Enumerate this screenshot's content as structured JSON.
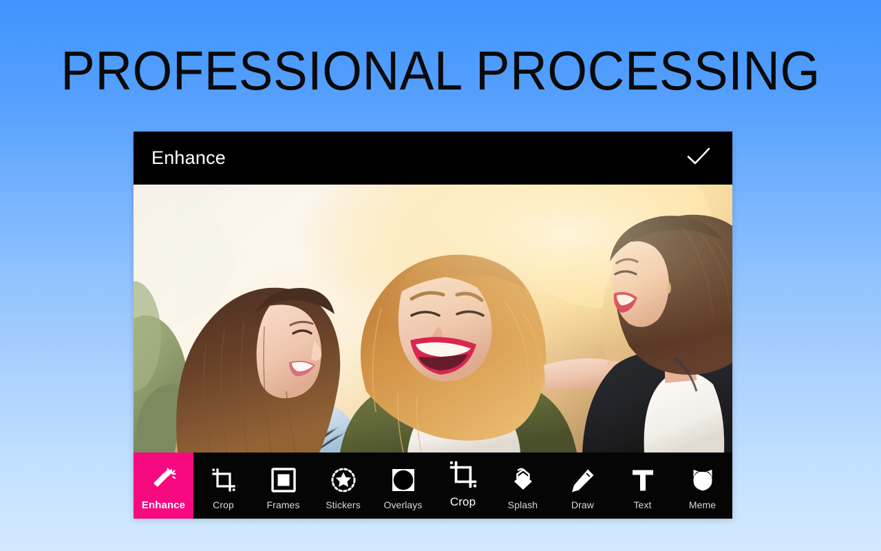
{
  "page": {
    "headline": "PROFESSIONAL PROCESSING",
    "background_top_color": "#3f94fd",
    "background_bottom_color": "#d3e9ff"
  },
  "app": {
    "topbar": {
      "title": "Enhance",
      "confirm_icon": "check-icon"
    },
    "photo": {
      "description": "Three young women laughing together outdoors in warm backlit sunlight",
      "subjects": [
        {
          "position": "left",
          "hair": "dark brown long",
          "clothing": "light blue striped shirt"
        },
        {
          "position": "center",
          "hair": "strawberry blonde long",
          "clothing": "olive green jacket over white tee",
          "lipstick": "#d8184b"
        },
        {
          "position": "right",
          "hair": "dark brown bob",
          "clothing": "white top with black leather jacket"
        }
      ]
    },
    "toolbar": {
      "active_index": 0,
      "accent_color": "#f7097f",
      "items": [
        {
          "label": "Enhance",
          "icon": "magic-wand-icon",
          "active": true,
          "emphasized": false
        },
        {
          "label": "Crop",
          "icon": "crop-icon",
          "active": false,
          "emphasized": false
        },
        {
          "label": "Frames",
          "icon": "frame-icon",
          "active": false,
          "emphasized": false
        },
        {
          "label": "Stickers",
          "icon": "sticker-star-icon",
          "active": false,
          "emphasized": false
        },
        {
          "label": "Overlays",
          "icon": "overlay-circle-icon",
          "active": false,
          "emphasized": false
        },
        {
          "label": "Crop",
          "icon": "crop-icon",
          "active": false,
          "emphasized": true
        },
        {
          "label": "Splash",
          "icon": "paint-bucket-icon",
          "active": false,
          "emphasized": false
        },
        {
          "label": "Draw",
          "icon": "pencil-icon",
          "active": false,
          "emphasized": false
        },
        {
          "label": "Text",
          "icon": "text-t-icon",
          "active": false,
          "emphasized": false
        },
        {
          "label": "Meme",
          "icon": "cat-face-icon",
          "active": false,
          "emphasized": false
        }
      ]
    }
  }
}
